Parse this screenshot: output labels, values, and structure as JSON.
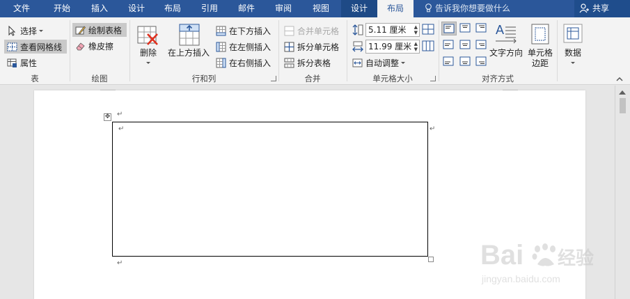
{
  "tabs": [
    "文件",
    "开始",
    "插入",
    "设计",
    "布局",
    "引用",
    "邮件",
    "审阅",
    "视图",
    "设计",
    "布局"
  ],
  "tell_me": "告诉我你想要做什么",
  "share": "共享",
  "groups": {
    "table": {
      "label": "表",
      "select": "选择",
      "view_gridlines": "查看网格线",
      "properties": "属性"
    },
    "draw": {
      "label": "绘图",
      "draw_table": "绘制表格",
      "eraser": "橡皮擦"
    },
    "rows_cols": {
      "label": "行和列",
      "delete": "删除",
      "insert_above": "在上方插入",
      "insert_below": "在下方插入",
      "insert_left": "在左侧插入",
      "insert_right": "在右侧插入"
    },
    "merge": {
      "label": "合并",
      "merge_cells": "合并单元格",
      "split_cells": "拆分单元格",
      "split_table": "拆分表格"
    },
    "cell_size": {
      "label": "单元格大小",
      "height": "5.11 厘米",
      "width": "11.99 厘米",
      "autofit": "自动调整"
    },
    "alignment": {
      "label": "对齐方式",
      "text_direction": "文字方向",
      "cell_margins": "单元格边距"
    },
    "data": {
      "label": "数据"
    }
  },
  "watermark": {
    "brand": "Bai",
    "brand_cn": "经验",
    "url": "jingyan.baidu.com"
  },
  "colors": {
    "tab_blue": "#2b579a",
    "ribbon_bg": "#f3f3f3",
    "doc_bg": "#e6e6e6"
  }
}
